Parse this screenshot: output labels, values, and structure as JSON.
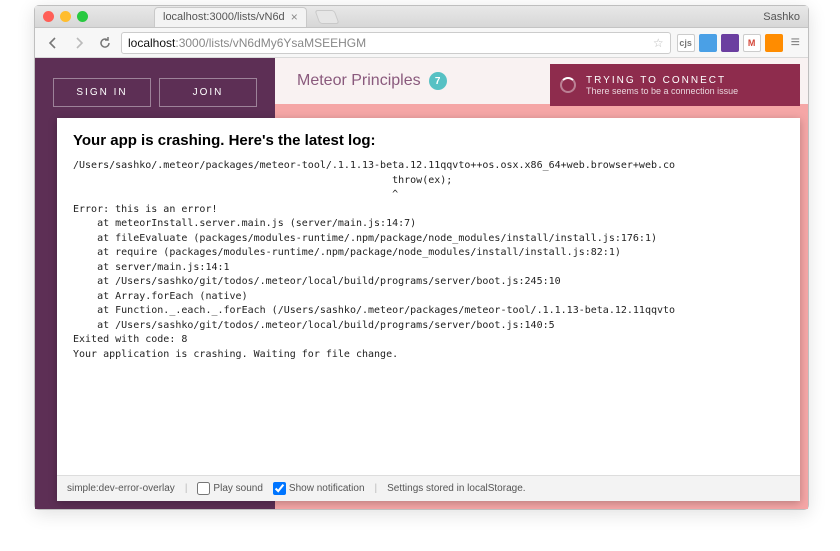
{
  "browser": {
    "profile_name": "Sashko",
    "tab_title": "localhost:3000/lists/vN6d",
    "url_display_domain": "localhost",
    "url_display_port_path": ":3000/lists/vN6dMy6YsaMSEEHGM",
    "ext_labels": {
      "cjs": "cjs",
      "gmail": "M"
    }
  },
  "app": {
    "auth": {
      "sign_in": "SIGN IN",
      "join": "JOIN"
    },
    "sidebar_add": "+",
    "header_title": "Meteor Principles",
    "header_badge": "7"
  },
  "connection_banner": {
    "title": "TRYING TO CONNECT",
    "subtitle": "There seems to be a connection issue"
  },
  "error_overlay": {
    "heading": "Your app is crashing. Here's the latest log:",
    "log": "/Users/sashko/.meteor/packages/meteor-tool/.1.1.13-beta.12.11qqvto++os.osx.x86_64+web.browser+web.co\n                                                     throw(ex);\n                                                     ^\nError: this is an error!\n    at meteorInstall.server.main.js (server/main.js:14:7)\n    at fileEvaluate (packages/modules-runtime/.npm/package/node_modules/install/install.js:176:1)\n    at require (packages/modules-runtime/.npm/package/node_modules/install/install.js:82:1)\n    at server/main.js:14:1\n    at /Users/sashko/git/todos/.meteor/local/build/programs/server/boot.js:245:10\n    at Array.forEach (native)\n    at Function._.each._.forEach (/Users/sashko/.meteor/packages/meteor-tool/.1.1.13-beta.12.11qqvto\n    at /Users/sashko/git/todos/.meteor/local/build/programs/server/boot.js:140:5\nExited with code: 8\nYour application is crashing. Waiting for file change.",
    "footer": {
      "pkg": "simple:dev-error-overlay",
      "play_sound": "Play sound",
      "show_notification": "Show notification",
      "settings": "Settings stored in localStorage."
    }
  }
}
